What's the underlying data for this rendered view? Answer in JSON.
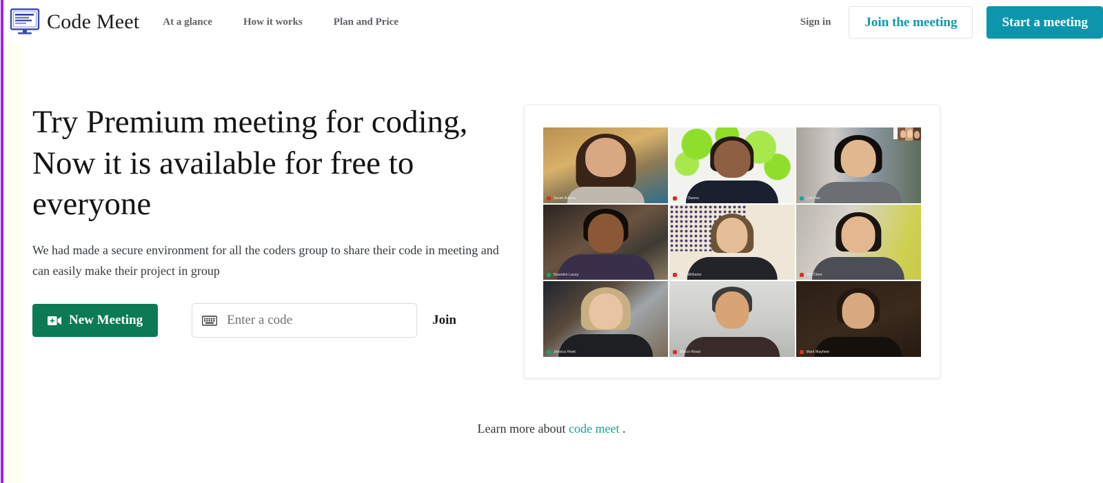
{
  "brand": {
    "name": "Code Meet",
    "logo_icon": "monitor-code-icon"
  },
  "nav": {
    "items": [
      {
        "label": "At a glance"
      },
      {
        "label": "How it works"
      },
      {
        "label": "Plan and Price"
      }
    ]
  },
  "header_actions": {
    "signin_label": "Sign in",
    "join_meeting_label": "Join the meeting",
    "start_meeting_label": "Start a meeting",
    "accent_color": "#0c96ad",
    "outline_text_color": "#0d9aae"
  },
  "hero": {
    "title": "Try Premium meeting for coding, Now it is available for free to everyone",
    "subtitle": "We had made a secure environment for all the coders group to share their code in meeting and can easily make their project in group",
    "new_meeting_label": "New Meeting",
    "new_meeting_icon": "video-camera-plus-icon",
    "new_meeting_color": "#0b7a55",
    "code_input_placeholder": "Enter a code",
    "code_input_value": "",
    "code_input_icon": "keyboard-icon",
    "join_label": "Join"
  },
  "video_card": {
    "toolbar_icons": [
      "people-icon",
      "pin-icon"
    ],
    "participants": [
      {
        "name": "Sarah Adams",
        "mic": "muted"
      },
      {
        "name": "Ben Owens",
        "mic": "muted"
      },
      {
        "name": "Lee Han",
        "mic": "teal"
      },
      {
        "name": "Deandre Lacey",
        "mic": "green"
      },
      {
        "name": "Eric Williams",
        "mic": "muted"
      },
      {
        "name": "Mei Chen",
        "mic": "muted"
      },
      {
        "name": "Jessica Hoek",
        "mic": "green"
      },
      {
        "name": "Marco Rossi",
        "mic": "muted"
      },
      {
        "name": "Mark Mayhew",
        "mic": "muted"
      }
    ]
  },
  "footer": {
    "learn_more_prefix": "Learn more about ",
    "learn_more_link": "code meet",
    "learn_more_suffix": " .",
    "link_color": "#19a08f"
  },
  "accent": {
    "left_stripe": "#a21fe0",
    "gutter": "#fdfff2"
  }
}
